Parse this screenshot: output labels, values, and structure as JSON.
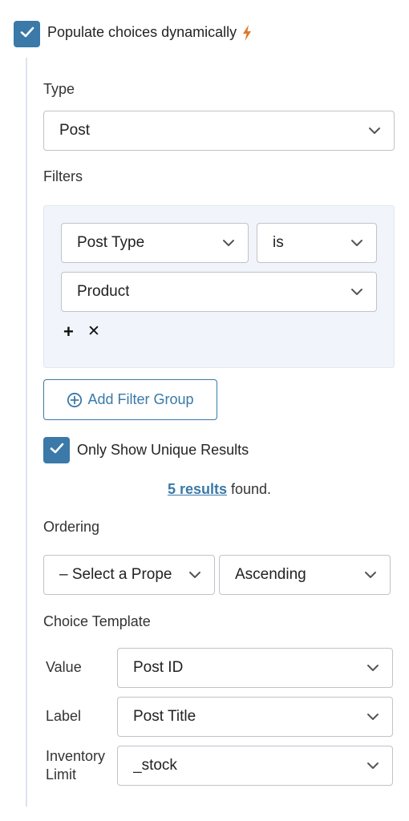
{
  "populate": {
    "checked": true,
    "label": "Populate choices dynamically",
    "icon": "lightning-bolt-icon",
    "icon_color": "#e0782a"
  },
  "type": {
    "label": "Type",
    "selected": "Post"
  },
  "filters": {
    "label": "Filters",
    "field": "Post Type",
    "operator": "is",
    "value": "Product",
    "add_icon": "+",
    "remove_icon": "✕"
  },
  "add_filter_group": {
    "label": "Add Filter Group",
    "icon": "plus-circle-icon"
  },
  "unique": {
    "checked": true,
    "label": "Only Show Unique Results"
  },
  "results": {
    "count_link": "5 results",
    "suffix": " found."
  },
  "ordering": {
    "label": "Ordering",
    "property": "– Select a Prope",
    "direction": "Ascending"
  },
  "choice_template": {
    "label": "Choice Template",
    "rows": [
      {
        "label": "Value",
        "selected": "Post ID"
      },
      {
        "label": "Label",
        "selected": "Post Title"
      },
      {
        "label": "Inventory Limit",
        "selected": "_stock"
      }
    ]
  },
  "colors": {
    "accent": "#3a79a8",
    "filter_bg": "#f1f5fb",
    "rail": "#dbe3ef"
  }
}
